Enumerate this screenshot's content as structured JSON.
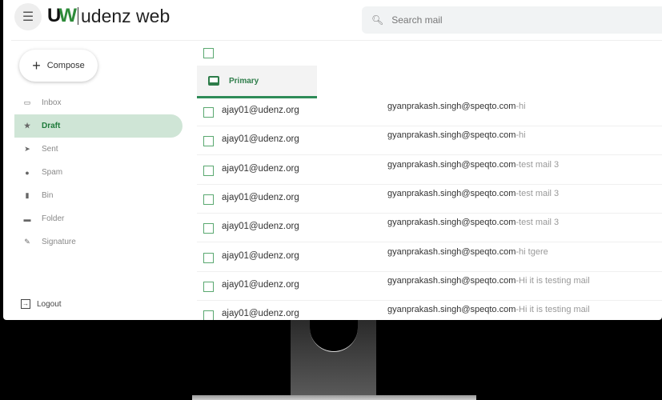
{
  "header": {
    "brand": "udenz web",
    "logo_mark": "UW",
    "search_placeholder": "Search mail"
  },
  "sidebar": {
    "compose": "Compose",
    "items": [
      {
        "label": "Inbox",
        "icon": "inbox-icon",
        "glyph": "▭"
      },
      {
        "label": "Draft",
        "icon": "star-icon",
        "glyph": "★",
        "active": true
      },
      {
        "label": "Sent",
        "icon": "send-icon",
        "glyph": "➤"
      },
      {
        "label": "Spam",
        "icon": "spam-icon",
        "glyph": "●"
      },
      {
        "label": "Bin",
        "icon": "trash-icon",
        "glyph": "▮"
      },
      {
        "label": "Folder",
        "icon": "folder-icon",
        "glyph": "▬"
      },
      {
        "label": "Signature",
        "icon": "signature-icon",
        "glyph": "✎"
      }
    ],
    "logout": "Logout"
  },
  "tabs": {
    "primary": "Primary"
  },
  "emails": [
    {
      "from": "ajay01@udenz.org",
      "to": "gyanprakash.singh@speqto.com",
      "subject": "-hi"
    },
    {
      "from": "ajay01@udenz.org",
      "to": "gyanprakash.singh@speqto.com",
      "subject": "-hi"
    },
    {
      "from": "ajay01@udenz.org",
      "to": "gyanprakash.singh@speqto.com",
      "subject": "-test mail 3"
    },
    {
      "from": "ajay01@udenz.org",
      "to": "gyanprakash.singh@speqto.com",
      "subject": "-test mail 3"
    },
    {
      "from": "ajay01@udenz.org",
      "to": "gyanprakash.singh@speqto.com",
      "subject": "-test mail 3"
    },
    {
      "from": "ajay01@udenz.org",
      "to": "gyanprakash.singh@speqto.com",
      "subject": "-hi tgere"
    },
    {
      "from": "ajay01@udenz.org",
      "to": "gyanprakash.singh@speqto.com",
      "subject": "-Hi it is testing mail"
    },
    {
      "from": "ajay01@udenz.org",
      "to": "gyanprakash.singh@speqto.com",
      "subject": "-Hi it is testing mail"
    }
  ]
}
